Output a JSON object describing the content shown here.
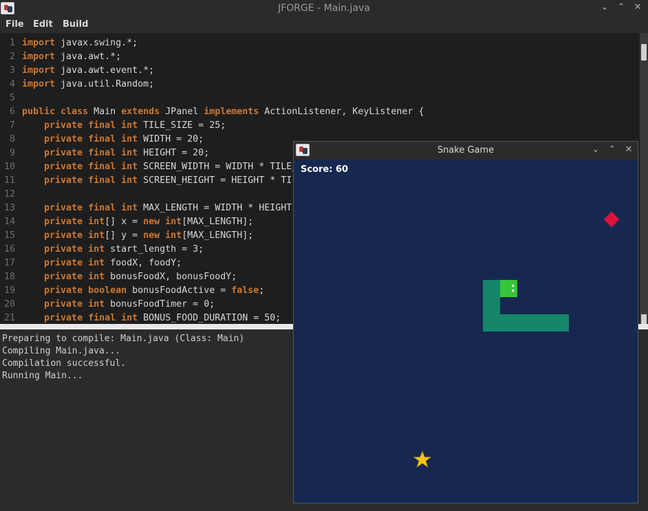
{
  "window": {
    "title": "JFORGE - Main.java",
    "controls": [
      "⌄",
      "⌃",
      "✕"
    ]
  },
  "menu": {
    "items": [
      "File",
      "Edit",
      "Build"
    ]
  },
  "editor": {
    "lines": [
      {
        "n": "1",
        "tokens": [
          {
            "t": "import",
            "k": true
          },
          {
            "t": " javax.swing.*;"
          }
        ]
      },
      {
        "n": "2",
        "tokens": [
          {
            "t": "import",
            "k": true
          },
          {
            "t": " java.awt.*;"
          }
        ]
      },
      {
        "n": "3",
        "tokens": [
          {
            "t": "import",
            "k": true
          },
          {
            "t": " java.awt.event.*;"
          }
        ]
      },
      {
        "n": "4",
        "tokens": [
          {
            "t": "import",
            "k": true
          },
          {
            "t": " java.util.Random;"
          }
        ]
      },
      {
        "n": "5",
        "tokens": []
      },
      {
        "n": "6",
        "tokens": [
          {
            "t": "public class",
            "k": true
          },
          {
            "t": " Main "
          },
          {
            "t": "extends",
            "k": true
          },
          {
            "t": " JPanel "
          },
          {
            "t": "implements",
            "k": true
          },
          {
            "t": " ActionListener, KeyListener {"
          }
        ]
      },
      {
        "n": "7",
        "tokens": [
          {
            "t": "    "
          },
          {
            "t": "private final int",
            "k": true
          },
          {
            "t": " TILE_SIZE = 25;"
          }
        ]
      },
      {
        "n": "8",
        "tokens": [
          {
            "t": "    "
          },
          {
            "t": "private final int",
            "k": true
          },
          {
            "t": " WIDTH = 20;"
          }
        ]
      },
      {
        "n": "9",
        "tokens": [
          {
            "t": "    "
          },
          {
            "t": "private final int",
            "k": true
          },
          {
            "t": " HEIGHT = 20;"
          }
        ]
      },
      {
        "n": "10",
        "tokens": [
          {
            "t": "    "
          },
          {
            "t": "private final int",
            "k": true
          },
          {
            "t": " SCREEN_WIDTH = WIDTH * TILE_"
          }
        ]
      },
      {
        "n": "11",
        "tokens": [
          {
            "t": "    "
          },
          {
            "t": "private final int",
            "k": true
          },
          {
            "t": " SCREEN_HEIGHT = HEIGHT * TI"
          }
        ]
      },
      {
        "n": "12",
        "tokens": []
      },
      {
        "n": "13",
        "tokens": [
          {
            "t": "    "
          },
          {
            "t": "private final int",
            "k": true
          },
          {
            "t": " MAX_LENGTH = WIDTH * HEIGHT"
          }
        ]
      },
      {
        "n": "14",
        "tokens": [
          {
            "t": "    "
          },
          {
            "t": "private int",
            "k": true
          },
          {
            "t": "[] x = "
          },
          {
            "t": "new int",
            "k": true
          },
          {
            "t": "[MAX_LENGTH];"
          }
        ]
      },
      {
        "n": "15",
        "tokens": [
          {
            "t": "    "
          },
          {
            "t": "private int",
            "k": true
          },
          {
            "t": "[] y = "
          },
          {
            "t": "new int",
            "k": true
          },
          {
            "t": "[MAX_LENGTH];"
          }
        ]
      },
      {
        "n": "16",
        "tokens": [
          {
            "t": "    "
          },
          {
            "t": "private int",
            "k": true
          },
          {
            "t": " start_length = 3;"
          }
        ]
      },
      {
        "n": "17",
        "tokens": [
          {
            "t": "    "
          },
          {
            "t": "private int",
            "k": true
          },
          {
            "t": " foodX, foodY;"
          }
        ]
      },
      {
        "n": "18",
        "tokens": [
          {
            "t": "    "
          },
          {
            "t": "private int",
            "k": true
          },
          {
            "t": " bonusFoodX, bonusFoodY;"
          }
        ]
      },
      {
        "n": "19",
        "tokens": [
          {
            "t": "    "
          },
          {
            "t": "private boolean",
            "k": true
          },
          {
            "t": " bonusFoodActive = "
          },
          {
            "t": "false",
            "k": true
          },
          {
            "t": ";"
          }
        ]
      },
      {
        "n": "20",
        "tokens": [
          {
            "t": "    "
          },
          {
            "t": "private int",
            "k": true
          },
          {
            "t": " bonusFoodTimer = 0;"
          }
        ]
      },
      {
        "n": "21",
        "tokens": [
          {
            "t": "    "
          },
          {
            "t": "private final int",
            "k": true
          },
          {
            "t": " BONUS_FOOD_DURATION = 50;"
          }
        ]
      }
    ]
  },
  "console": {
    "lines": [
      "Preparing to compile: Main.java (Class: Main)",
      "Compiling Main.java...",
      "Compilation successful.",
      "Running Main..."
    ]
  },
  "snake_window": {
    "title": "Snake Game",
    "controls": [
      "⌄",
      "⌃",
      "✕"
    ],
    "score_text": "Score: 60",
    "colors": {
      "background": "#162850",
      "snake_body": "#16866a",
      "snake_head": "#35c63a",
      "food": "#dc143c",
      "bonus_food": "#f5c518"
    },
    "food_icon": "red-diamond-icon",
    "bonus_food_icon": "star-icon"
  }
}
